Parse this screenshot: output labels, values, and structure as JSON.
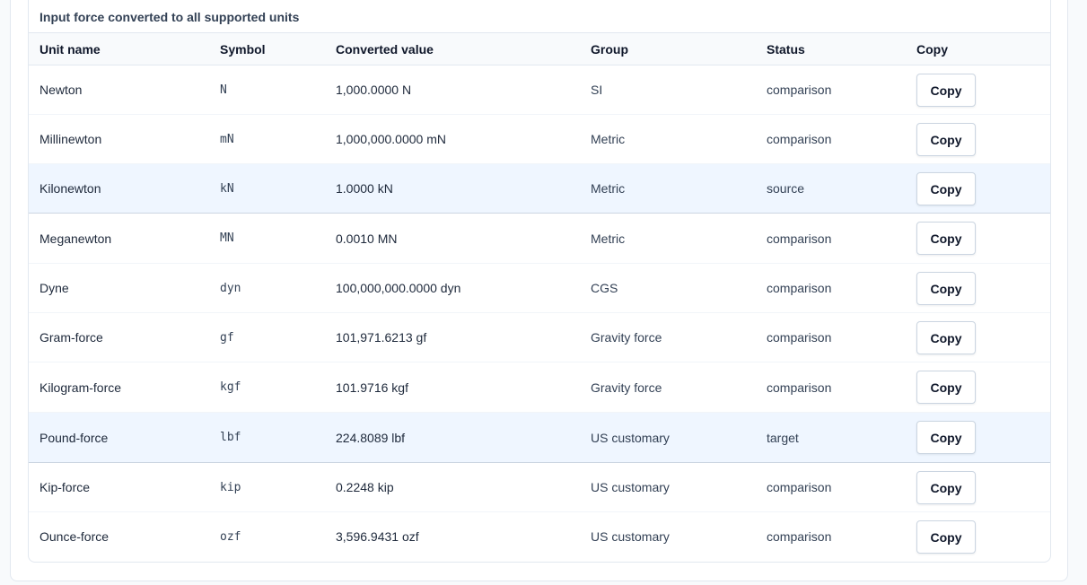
{
  "caption": "Input force converted to all supported units",
  "columns": {
    "unit_name": "Unit name",
    "symbol": "Symbol",
    "converted_value": "Converted value",
    "group": "Group",
    "status": "Status",
    "copy": "Copy"
  },
  "copy_label": "Copy",
  "highlight_color": "#eff6ff",
  "rows": [
    {
      "name": "Newton",
      "symbol": "N",
      "value": "1,000.0000 N",
      "group": "SI",
      "status": "comparison"
    },
    {
      "name": "Millinewton",
      "symbol": "mN",
      "value": "1,000,000.0000 mN",
      "group": "Metric",
      "status": "comparison"
    },
    {
      "name": "Kilonewton",
      "symbol": "kN",
      "value": "1.0000 kN",
      "group": "Metric",
      "status": "source"
    },
    {
      "name": "Meganewton",
      "symbol": "MN",
      "value": "0.0010 MN",
      "group": "Metric",
      "status": "comparison"
    },
    {
      "name": "Dyne",
      "symbol": "dyn",
      "value": "100,000,000.0000 dyn",
      "group": "CGS",
      "status": "comparison"
    },
    {
      "name": "Gram-force",
      "symbol": "gf",
      "value": "101,971.6213 gf",
      "group": "Gravity force",
      "status": "comparison"
    },
    {
      "name": "Kilogram-force",
      "symbol": "kgf",
      "value": "101.9716 kgf",
      "group": "Gravity force",
      "status": "comparison"
    },
    {
      "name": "Pound-force",
      "symbol": "lbf",
      "value": "224.8089 lbf",
      "group": "US customary",
      "status": "target"
    },
    {
      "name": "Kip-force",
      "symbol": "kip",
      "value": "0.2248 kip",
      "group": "US customary",
      "status": "comparison"
    },
    {
      "name": "Ounce-force",
      "symbol": "ozf",
      "value": "3,596.9431 ozf",
      "group": "US customary",
      "status": "comparison"
    }
  ]
}
